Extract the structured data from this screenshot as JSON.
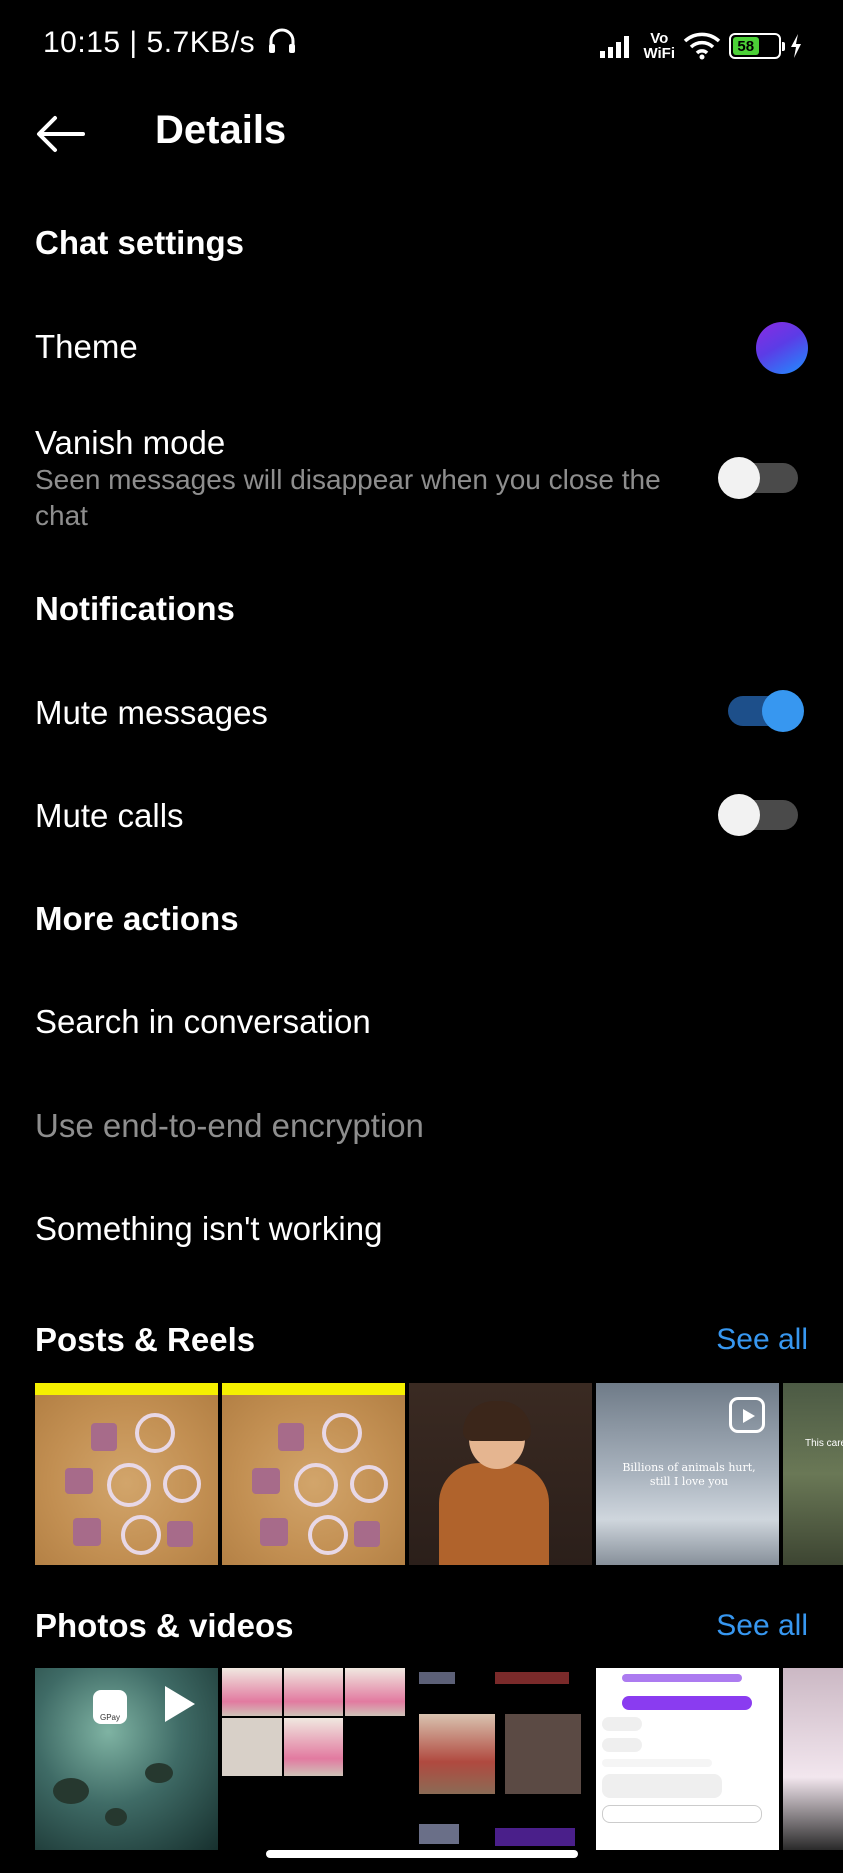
{
  "status_bar": {
    "time_speed": "10:15 | 5.7KB/s",
    "vowifi_top": "Vo",
    "vowifi_bottom": "WiFi",
    "battery": "58"
  },
  "header": {
    "title": "Details"
  },
  "chat_settings": {
    "title": "Chat settings",
    "theme_label": "Theme",
    "vanish_label": "Vanish mode",
    "vanish_sub": "Seen messages will disappear when you close the chat",
    "vanish_on": false
  },
  "notifications": {
    "title": "Notifications",
    "mute_messages_label": "Mute messages",
    "mute_messages_on": true,
    "mute_calls_label": "Mute calls",
    "mute_calls_on": false
  },
  "more_actions": {
    "title": "More actions",
    "search": "Search in conversation",
    "e2e": "Use end-to-end encryption",
    "report": "Something isn't working"
  },
  "posts_reels": {
    "title": "Posts & Reels",
    "see_all": "See all",
    "sky_caption": "Billions of animals hurt, still I love you",
    "partial_caption": "This care"
  },
  "photos_videos": {
    "title": "Photos & videos",
    "see_all": "See all",
    "gpay": "GPay"
  },
  "colors": {
    "accent": "#3797f0",
    "muted": "#8e8e8e",
    "background": "#000000"
  }
}
